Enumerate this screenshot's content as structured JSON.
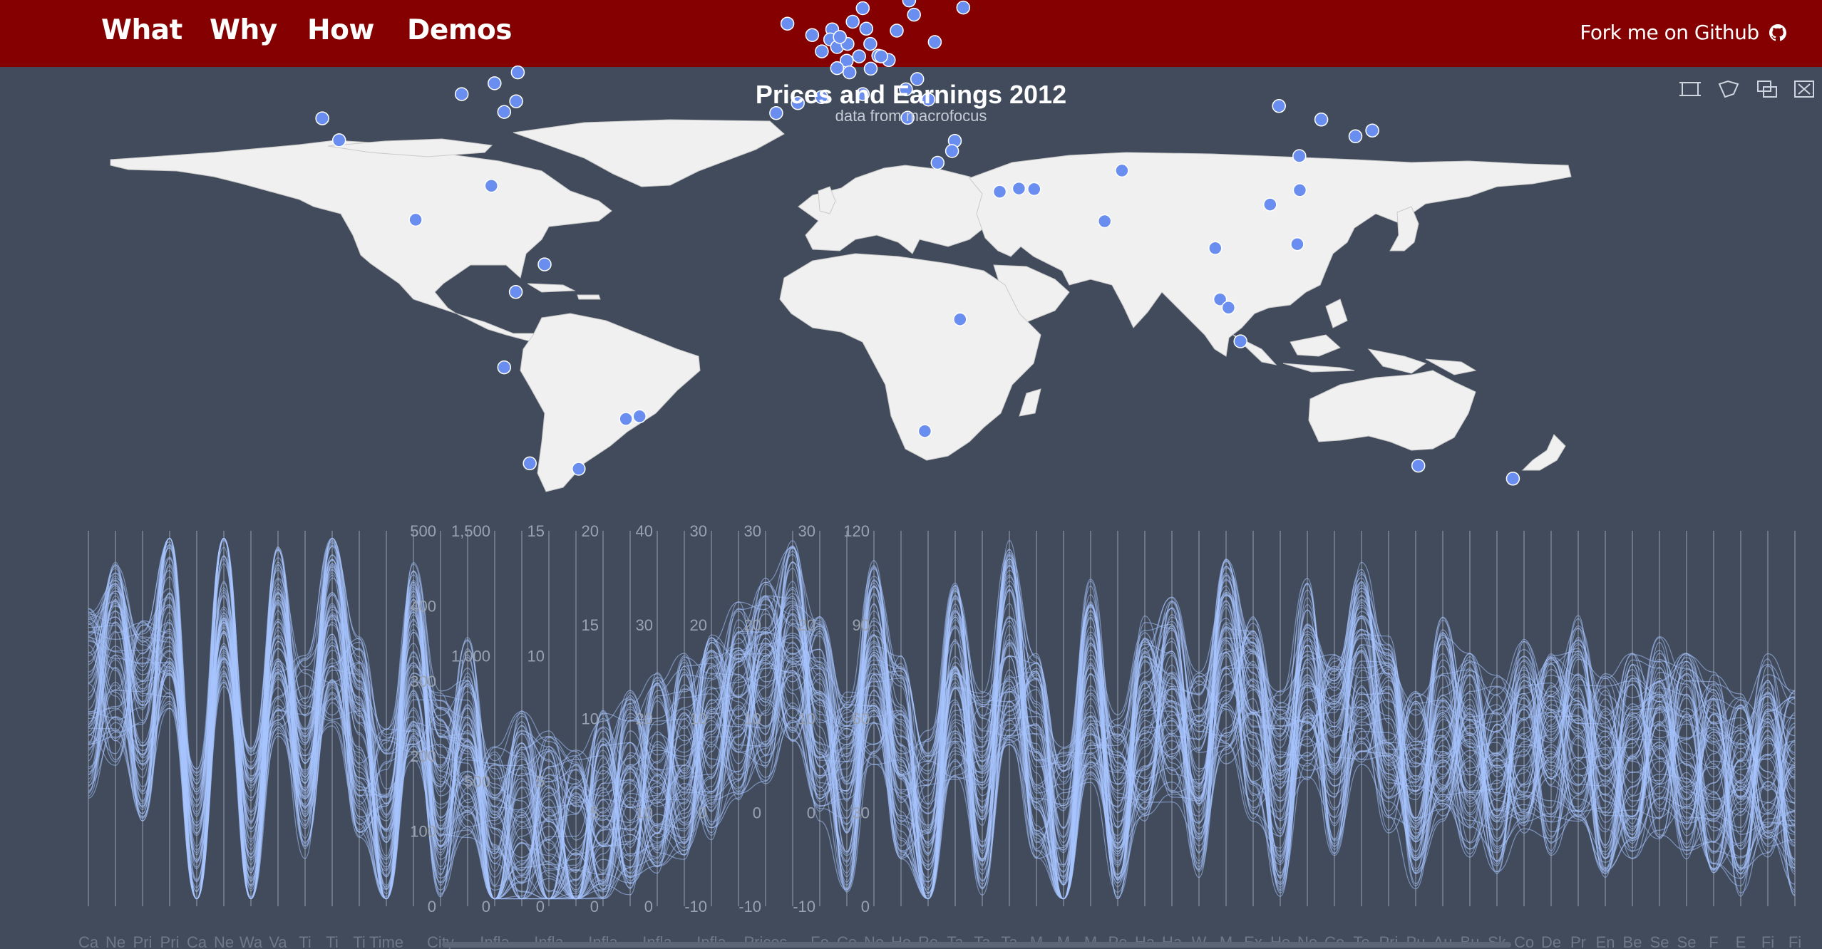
{
  "nav": {
    "items": [
      "What",
      "Why",
      "How",
      "Demos"
    ],
    "fork_label": "Fork me on Github"
  },
  "chart": {
    "title": "Prices and Earnings 2012",
    "subtitle": "data from macrofocus"
  },
  "toolbox": {
    "icons": [
      "area-zoom-icon",
      "lasso-select-icon",
      "rect-select-icon",
      "clear-select-icon"
    ]
  },
  "colors": {
    "topbar": "#850000",
    "background": "#414b5b",
    "land": "#f0f0f0",
    "city_point": "#6a8ef0",
    "series_line": "#a8c4ff"
  },
  "chart_data": [
    {
      "type": "scatter",
      "map": "world",
      "description_shown": "city markers",
      "points": [
        [
          -122.4,
          37.8
        ],
        [
          -118.2,
          34.0
        ],
        [
          -99.1,
          19.4
        ],
        [
          -87.6,
          41.9
        ],
        [
          -79.4,
          43.7
        ],
        [
          -73.6,
          45.5
        ],
        [
          -74.0,
          40.7
        ],
        [
          -77.0,
          38.9
        ],
        [
          -80.2,
          25.8
        ],
        [
          -66.9,
          10.5
        ],
        [
          -74.1,
          4.7
        ],
        [
          -77.0,
          -12.0
        ],
        [
          -70.6,
          -33.4
        ],
        [
          -58.4,
          -34.6
        ],
        [
          -46.6,
          -23.5
        ],
        [
          -43.2,
          -22.9
        ],
        [
          -9.1,
          38.7
        ],
        [
          -3.7,
          40.4
        ],
        [
          2.2,
          41.4
        ],
        [
          -6.3,
          53.3
        ],
        [
          -0.1,
          51.5
        ],
        [
          2.3,
          48.9
        ],
        [
          4.9,
          52.4
        ],
        [
          4.4,
          50.8
        ],
        [
          6.1,
          49.6
        ],
        [
          8.5,
          47.4
        ],
        [
          6.1,
          46.2
        ],
        [
          11.6,
          48.1
        ],
        [
          8.7,
          50.1
        ],
        [
          6.8,
          51.2
        ],
        [
          10.0,
          53.6
        ],
        [
          13.4,
          52.5
        ],
        [
          12.5,
          55.7
        ],
        [
          10.8,
          59.9
        ],
        [
          18.1,
          59.3
        ],
        [
          24.9,
          60.2
        ],
        [
          24.1,
          56.9
        ],
        [
          25.3,
          54.7
        ],
        [
          21.0,
          52.2
        ],
        [
          14.4,
          50.1
        ],
        [
          16.4,
          48.2
        ],
        [
          19.0,
          47.5
        ],
        [
          17.1,
          48.1
        ],
        [
          14.5,
          46.1
        ],
        [
          12.5,
          41.9
        ],
        [
          9.2,
          45.5
        ],
        [
          26.1,
          44.4
        ],
        [
          23.3,
          42.7
        ],
        [
          23.7,
          37.9
        ],
        [
          28.9,
          41.0
        ],
        [
          30.5,
          50.4
        ],
        [
          37.6,
          55.8
        ],
        [
          35.5,
          33.9
        ],
        [
          34.8,
          32.1
        ],
        [
          31.2,
          30.0
        ],
        [
          46.7,
          24.7
        ],
        [
          51.5,
          25.3
        ],
        [
          55.3,
          25.2
        ],
        [
          36.8,
          -1.3
        ],
        [
          28.0,
          -26.2
        ],
        [
          72.9,
          19.1
        ],
        [
          77.2,
          28.6
        ],
        [
          121.5,
          31.2
        ],
        [
          116.4,
          39.9
        ],
        [
          114.2,
          22.3
        ],
        [
          121.6,
          25.0
        ],
        [
          126.98,
          37.6
        ],
        [
          139.7,
          35.7
        ],
        [
          135.5,
          34.7
        ],
        [
          120.98,
          14.6
        ],
        [
          100.5,
          13.8
        ],
        [
          101.7,
          3.1
        ],
        [
          103.8,
          1.3
        ],
        [
          106.8,
          -6.2
        ],
        [
          151.2,
          -33.9
        ],
        [
          174.8,
          -36.8
        ]
      ]
    },
    {
      "type": "line",
      "variant": "parallel-coordinates",
      "axis_ticks": [
        {
          "labels": [
            "500",
            "400",
            "300",
            "200",
            "100",
            "0"
          ]
        },
        {
          "labels": [
            "1,500",
            "1,000",
            "500",
            "0"
          ]
        },
        {
          "labels": [
            "15",
            "10",
            "5",
            "0"
          ]
        },
        {
          "labels": [
            "20",
            "15",
            "10",
            "5",
            "0"
          ]
        },
        {
          "labels": [
            "40",
            "30",
            "20",
            "10",
            "0"
          ]
        },
        {
          "labels": [
            "30",
            "20",
            "10",
            "0",
            "-10"
          ]
        },
        {
          "labels": [
            "30",
            "20",
            "10",
            "0",
            "-10"
          ]
        },
        {
          "labels": [
            "30",
            "20",
            "10",
            "0",
            "-10"
          ]
        },
        {
          "labels": [
            "120",
            "90",
            "60",
            "30",
            "0"
          ]
        }
      ],
      "dimension_names": [
        "Ca",
        "Ne",
        "Pri",
        "Pri",
        "Ca",
        "Ne",
        "Wa",
        "Va",
        "Ti",
        "Ti",
        "Ti",
        "Time",
        "",
        "City",
        "",
        "Infla",
        "",
        "Infla",
        "",
        "Infla",
        "",
        "Infla",
        "",
        "Infla",
        "",
        "Prices",
        "",
        "Fo",
        "Co",
        "Ne",
        "Ho",
        "Re",
        "Ta",
        "Ta",
        "Ta",
        "M",
        "M",
        "M",
        "Pe",
        "Ha",
        "Ha",
        "W",
        "M",
        "Ex",
        "Ho",
        "Ne",
        "Co",
        "Te",
        "Pri",
        "Pu",
        "Au",
        "Bu",
        "Sk",
        "Co",
        "De",
        "Pr",
        "En",
        "Be",
        "Se",
        "Se",
        "F",
        "E",
        "Fi",
        "Fi"
      ]
    }
  ]
}
